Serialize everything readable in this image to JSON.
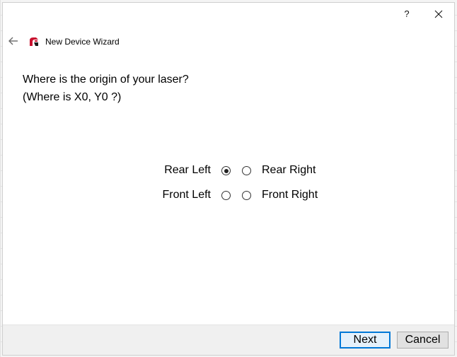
{
  "titlebar": {
    "help_label": "?",
    "close_icon": "close-icon"
  },
  "header": {
    "back_icon": "back-arrow-icon",
    "app_icon": "app-logo-icon",
    "title": "New Device Wizard"
  },
  "question": {
    "line1": "Where is the origin of your laser?",
    "line2": "(Where is X0, Y0 ?)"
  },
  "origin_options": [
    {
      "label": "Rear Left",
      "selected": true
    },
    {
      "label": "Rear Right",
      "selected": false
    },
    {
      "label": "Front Left",
      "selected": false
    },
    {
      "label": "Front Right",
      "selected": false
    }
  ],
  "footer": {
    "next_label": "Next",
    "cancel_label": "Cancel"
  },
  "colors": {
    "accent": "#0078d7",
    "app_icon_red": "#c8102e"
  }
}
